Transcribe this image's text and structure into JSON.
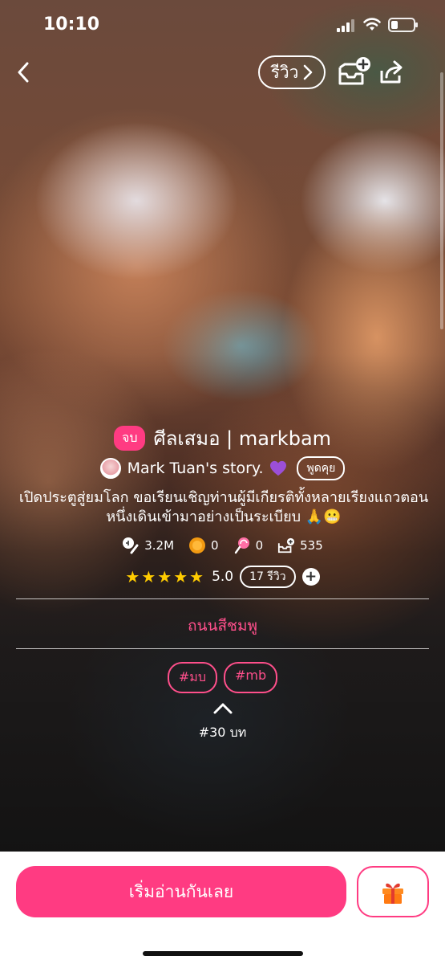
{
  "status_bar": {
    "time": "10:10"
  },
  "nav": {
    "review_label": "รีวิว"
  },
  "story": {
    "end_badge": "จบ",
    "title": "ศีลเสมอ | markbam",
    "author": "Mark Tuan's story.",
    "chat_label": "พูดคุย",
    "description": "เปิดประตูสู่ยมโลก ขอเรียนเชิญท่านผู้มีเกียรติทั้งหลายเรียงแถวตอนหนึ่งเดินเข้ามาอย่างเป็นระเบียบ 🙏😬",
    "stats": {
      "views": "3.2M",
      "coins": "0",
      "candy": "0",
      "library": "535"
    },
    "rating": {
      "stars": 5,
      "score": "5.0",
      "review_count": "17 รีวิว"
    },
    "category": "ถนนสีชมพู",
    "tags": [
      "#มบ",
      "#mb"
    ],
    "episodes": "#30 บท"
  },
  "bottom": {
    "start_label": "เริ่มอ่านกันเลย"
  },
  "colors": {
    "accent": "#ff3b82",
    "pink_text": "#ff4f8b",
    "star": "#ffcc00"
  },
  "icons": [
    "back-icon",
    "chevron-right-icon",
    "library-add-icon",
    "share-icon",
    "views-icon",
    "coin-icon",
    "candy-icon",
    "library-icon",
    "star-icon",
    "plus-icon",
    "chevron-up-icon",
    "gift-icon"
  ]
}
